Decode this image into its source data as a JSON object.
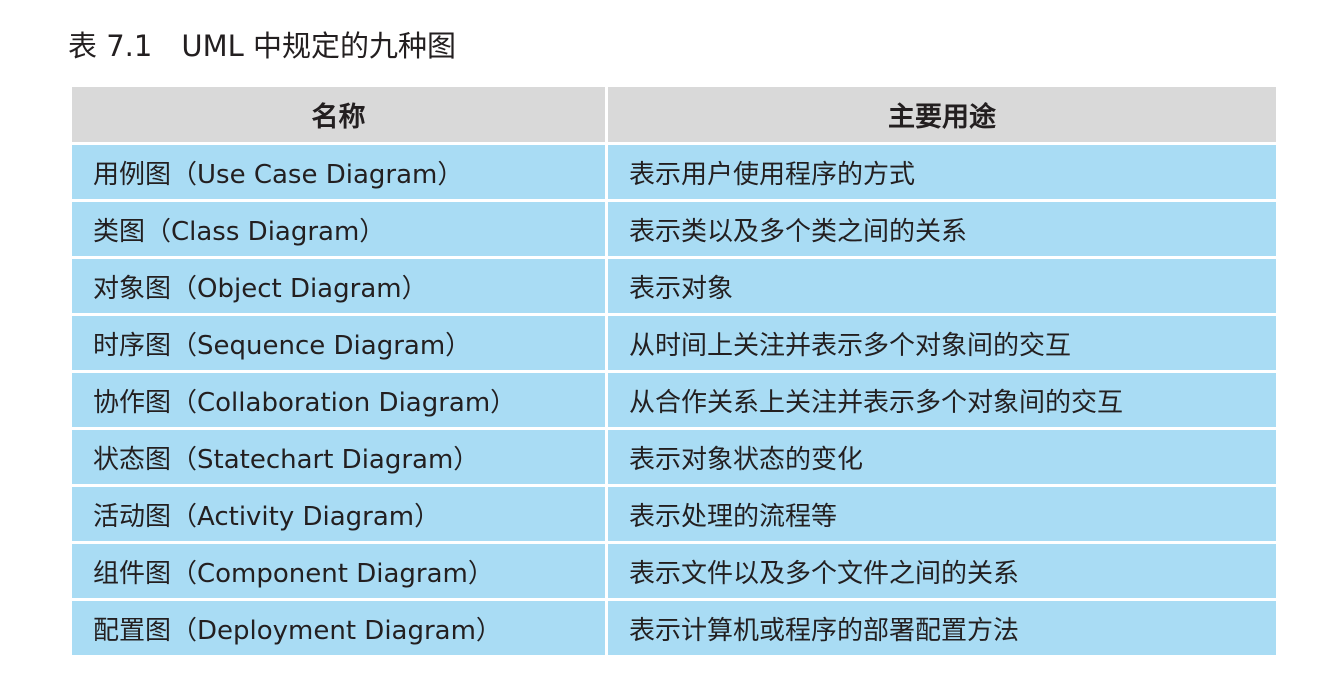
{
  "caption": "表 7.1　UML 中规定的九种图",
  "table": {
    "headers": [
      "名称",
      "主要用途"
    ],
    "rows": [
      {
        "name": "用例图（Use Case Diagram）",
        "purpose": "表示用户使用程序的方式"
      },
      {
        "name": "类图（Class Diagram）",
        "purpose": "表示类以及多个类之间的关系"
      },
      {
        "name": "对象图（Object Diagram）",
        "purpose": "表示对象"
      },
      {
        "name": "时序图（Sequence Diagram）",
        "purpose": "从时间上关注并表示多个对象间的交互"
      },
      {
        "name": "协作图（Collaboration Diagram）",
        "purpose": "从合作关系上关注并表示多个对象间的交互"
      },
      {
        "name": "状态图（Statechart Diagram）",
        "purpose": "表示对象状态的变化"
      },
      {
        "name": "活动图（Activity Diagram）",
        "purpose": "表示处理的流程等"
      },
      {
        "name": "组件图（Component Diagram）",
        "purpose": "表示文件以及多个文件之间的关系"
      },
      {
        "name": "配置图（Deployment Diagram）",
        "purpose": "表示计算机或程序的部署配置方法"
      }
    ]
  },
  "colors": {
    "header_bg": "#d9d9d9",
    "row_bg": "#a9dcf4",
    "text": "#231f20"
  }
}
